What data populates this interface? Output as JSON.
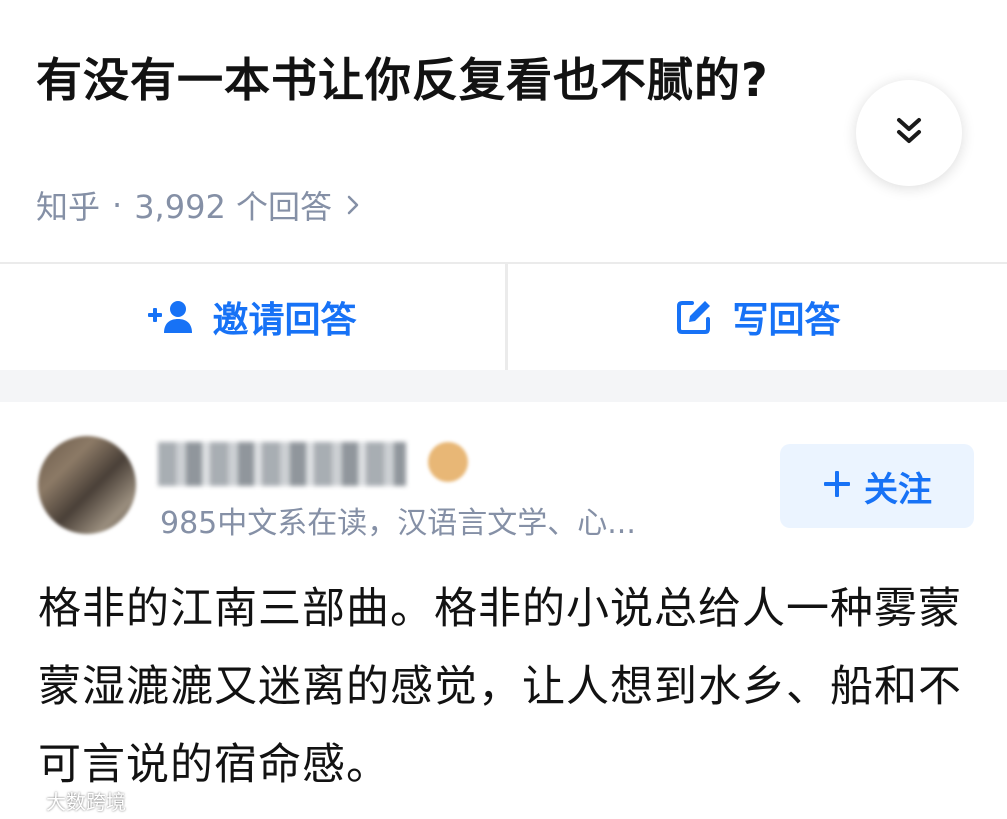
{
  "question": {
    "title": "有没有一本书让你反复看也不腻的?",
    "source": "知乎",
    "separator": "·",
    "answer_count": "3,992 个回答"
  },
  "actions": {
    "invite_label": "邀请回答",
    "write_label": "写回答"
  },
  "answer": {
    "author_bio": "985中文系在读，汉语言文学、心...",
    "follow_label": "关注",
    "text": "格非的江南三部曲。格非的小说总给人一种雾蒙蒙湿漉漉又迷离的感觉，让人想到水乡、船和不可言说的宿命感。"
  },
  "watermark": {
    "text": "大数跨境"
  },
  "colors": {
    "accent": "#1772f6",
    "meta_gray": "#8590a6",
    "follow_bg": "#ebf4ff",
    "band_bg": "#f4f5f7"
  },
  "icons": {
    "expand": "double-chevron-down-icon",
    "meta_chevron": "chevron-right-icon",
    "invite": "add-user-icon",
    "write": "edit-icon",
    "follow": "plus-icon"
  }
}
